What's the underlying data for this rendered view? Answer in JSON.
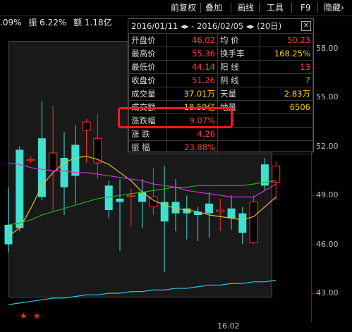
{
  "toolbar": {
    "items": [
      "前复权",
      "叠加",
      "画线",
      "工具",
      "F9",
      "隐藏"
    ],
    "hide_arrow": "›"
  },
  "infoline": {
    "change": ".09%",
    "amplitude": "振 6.22%",
    "amount": "额 1.18亿"
  },
  "popup": {
    "date_from": "2016/01/11",
    "date_to": "2016/02/05",
    "period": "(20日)",
    "nav": "◂▸",
    "close": "✕",
    "rows": [
      {
        "k1": "开盘价",
        "v1": "46.02",
        "c1": "red",
        "k2": "均  价",
        "v2": "50.23",
        "c2": "red"
      },
      {
        "k1": "最高价",
        "v1": "55.36",
        "c1": "red",
        "k2": "换手率",
        "v2": "168.25%",
        "c2": "yellow"
      },
      {
        "k1": "最低价",
        "v1": "44.14",
        "c1": "red",
        "k2": "阳  线",
        "v2": "13",
        "c2": "red"
      },
      {
        "k1": "收盘价",
        "v1": "51.26",
        "c1": "red",
        "k2": "阴  线",
        "v2": "7",
        "c2": "green"
      },
      {
        "k1": "成交量",
        "v1": "37.01万",
        "c1": "yellow",
        "k2": "天量",
        "v2": "2.83万",
        "c2": "yellow"
      },
      {
        "k1": "成交额",
        "v1": "18.59亿",
        "c1": "yellow",
        "k2": "地量",
        "v2": "6506",
        "c2": "yellow"
      },
      {
        "k1": "涨跌幅",
        "v1": "9.07%",
        "c1": "red",
        "k2": "",
        "v2": "",
        "c2": "red"
      },
      {
        "k1": "涨  跌",
        "v1": "4.26",
        "c1": "red",
        "k2": "",
        "v2": "",
        "c2": "red"
      },
      {
        "k1": "振  幅",
        "v1": "23.88%",
        "c1": "red",
        "k2": "",
        "v2": "",
        "c2": "red"
      }
    ]
  },
  "chart_data": {
    "type": "candlestick",
    "y_ticks": [
      "58.00",
      "55.00",
      "52.00",
      "49.00",
      "46.00",
      "43.00"
    ],
    "y_tick_values": [
      58,
      55,
      52,
      49,
      46,
      43
    ],
    "x_label": "16.02",
    "ylim": [
      42,
      59.5
    ],
    "candles": [
      {
        "o": 47.2,
        "c": 46.0,
        "h": 49.5,
        "l": 45.5
      },
      {
        "o": 51.8,
        "c": 47.0,
        "h": 52.0,
        "l": 46.8
      },
      {
        "o": 51.2,
        "c": 51.2,
        "h": 51.4,
        "l": 51.0
      },
      {
        "o": 52.5,
        "c": 48.9,
        "h": 54.8,
        "l": 48.7
      },
      {
        "o": 50.5,
        "c": 51.6,
        "h": 54.5,
        "l": 48.0
      },
      {
        "o": 51.3,
        "c": 49.5,
        "h": 52.9,
        "l": 47.8
      },
      {
        "o": 52.1,
        "c": 50.2,
        "h": 53.3,
        "l": 48.5
      },
      {
        "o": 53.0,
        "c": 53.5,
        "h": 53.7,
        "l": 51.0
      },
      {
        "o": 51.0,
        "c": 52.5,
        "h": 54.0,
        "l": 50.0
      },
      {
        "o": 49.6,
        "c": 48.1,
        "h": 49.9,
        "l": 47.6
      },
      {
        "o": 48.8,
        "c": 48.6,
        "h": 50.0,
        "l": 45.6
      },
      {
        "o": 49.0,
        "c": 49.0,
        "h": 49.4,
        "l": 47.1
      },
      {
        "o": 49.2,
        "c": 48.6,
        "h": 50.0,
        "l": 47.0
      },
      {
        "o": 48.3,
        "c": 48.9,
        "h": 50.7,
        "l": 47.8
      },
      {
        "o": 48.6,
        "c": 47.4,
        "h": 50.8,
        "l": 44.3
      },
      {
        "o": 48.6,
        "c": 47.9,
        "h": 50.0,
        "l": 46.8
      },
      {
        "o": 48.2,
        "c": 47.9,
        "h": 49.0,
        "l": 46.3
      },
      {
        "o": 48.0,
        "c": 47.8,
        "h": 48.3,
        "l": 46.2
      },
      {
        "o": 48.5,
        "c": 47.9,
        "h": 49.2,
        "l": 46.4
      },
      {
        "o": 48.0,
        "c": 48.1,
        "h": 48.8,
        "l": 46.8
      },
      {
        "o": 48.2,
        "c": 47.6,
        "h": 49.0,
        "l": 46.9
      },
      {
        "o": 47.9,
        "c": 46.7,
        "h": 48.3,
        "l": 46.0
      },
      {
        "o": 46.1,
        "c": 48.6,
        "h": 49.0,
        "l": 46.0
      },
      {
        "o": 50.9,
        "c": 49.6,
        "h": 51.3,
        "l": 49.3
      },
      {
        "o": 49.8,
        "c": 50.8,
        "h": 51.1,
        "l": 48.7
      }
    ],
    "ma_lines": [
      {
        "name": "MA5",
        "color": "#e8c020",
        "values": [
          46.5,
          47.0,
          48.2,
          49.6,
          50.4,
          51.0,
          51.3,
          51.4,
          51.2,
          50.9,
          50.4,
          49.9,
          49.2,
          48.7,
          48.4,
          48.2,
          48.1,
          48.0,
          47.8,
          47.7,
          47.6,
          47.5,
          47.7,
          48.3,
          48.9
        ]
      },
      {
        "name": "MA10",
        "color": "#d030d0",
        "values": [
          51.0,
          50.9,
          50.7,
          50.6,
          50.5,
          50.5,
          50.4,
          50.4,
          50.3,
          50.2,
          50.1,
          50.0,
          49.9,
          49.7,
          49.6,
          49.5,
          49.3,
          49.2,
          49.1,
          49.0,
          48.9,
          48.9,
          48.9,
          49.3,
          49.7
        ]
      },
      {
        "name": "MA20",
        "color": "#20b020",
        "values": [
          47.2,
          47.3,
          47.5,
          47.8,
          48.0,
          48.2,
          48.4,
          48.6,
          48.8,
          48.9,
          49.0,
          49.1,
          49.2,
          49.3,
          49.4,
          49.5,
          49.5,
          49.6,
          49.6,
          49.6,
          49.6,
          49.6,
          49.7,
          49.8,
          49.9
        ]
      },
      {
        "name": "MA60",
        "color": "#30c8e0",
        "values": [
          42.3,
          42.4,
          42.5,
          42.6,
          42.7,
          42.7,
          42.8,
          42.9,
          42.9,
          43.0,
          43.0,
          43.1,
          43.1,
          43.2,
          43.2,
          43.3,
          43.3,
          43.4,
          43.5,
          43.5,
          43.6,
          43.6,
          43.7,
          43.7,
          43.8
        ]
      }
    ]
  }
}
